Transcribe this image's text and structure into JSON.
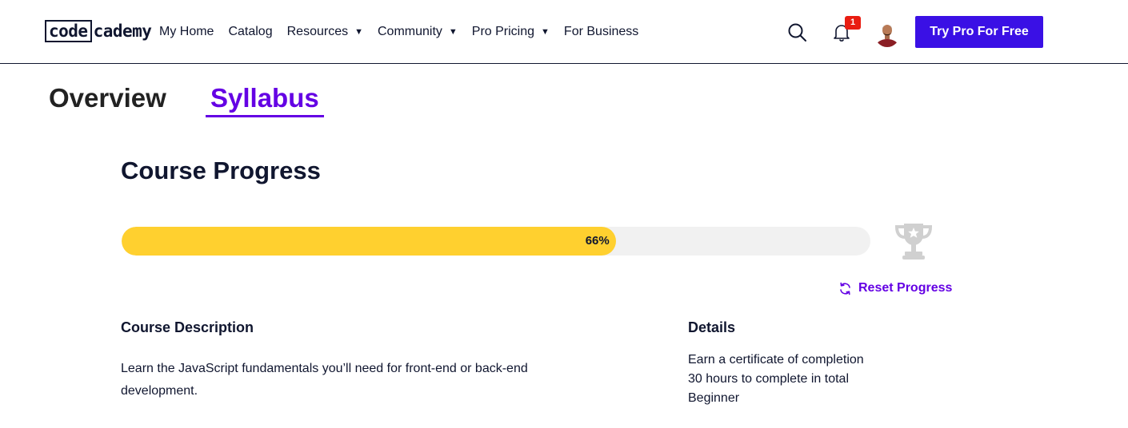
{
  "brand": {
    "logo_box": "code",
    "logo_rest": "cademy"
  },
  "nav": {
    "items": [
      {
        "label": "My Home",
        "dropdown": false
      },
      {
        "label": "Catalog",
        "dropdown": false
      },
      {
        "label": "Resources",
        "dropdown": true
      },
      {
        "label": "Community",
        "dropdown": true
      },
      {
        "label": "Pro Pricing",
        "dropdown": true
      },
      {
        "label": "For Business",
        "dropdown": false
      }
    ],
    "caret": "▼"
  },
  "header": {
    "icons": [
      "search-icon",
      "bell-icon",
      "avatar"
    ],
    "notification_count": "1",
    "cta_label": "Try Pro For Free"
  },
  "tabs": {
    "overview": "Overview",
    "syllabus": "Syllabus",
    "active": "Syllabus"
  },
  "progress": {
    "title": "Course Progress",
    "percent": 66,
    "percent_label": "66%",
    "reset_label": "Reset Progress"
  },
  "description": {
    "title": "Course Description",
    "text": "Learn the JavaScript fundamentals you’ll need for front-end or back-end development."
  },
  "details": {
    "title": "Details",
    "items": [
      "Earn a certificate of completion",
      "30 hours to complete in total",
      "Beginner"
    ]
  },
  "colors": {
    "brand_purple": "#3a10e5",
    "link_purple": "#6400e4",
    "progress_yellow": "#ffd02f",
    "track_gray": "#f1f1f1",
    "badge_red": "#e91c11",
    "text_navy": "#10162f"
  }
}
